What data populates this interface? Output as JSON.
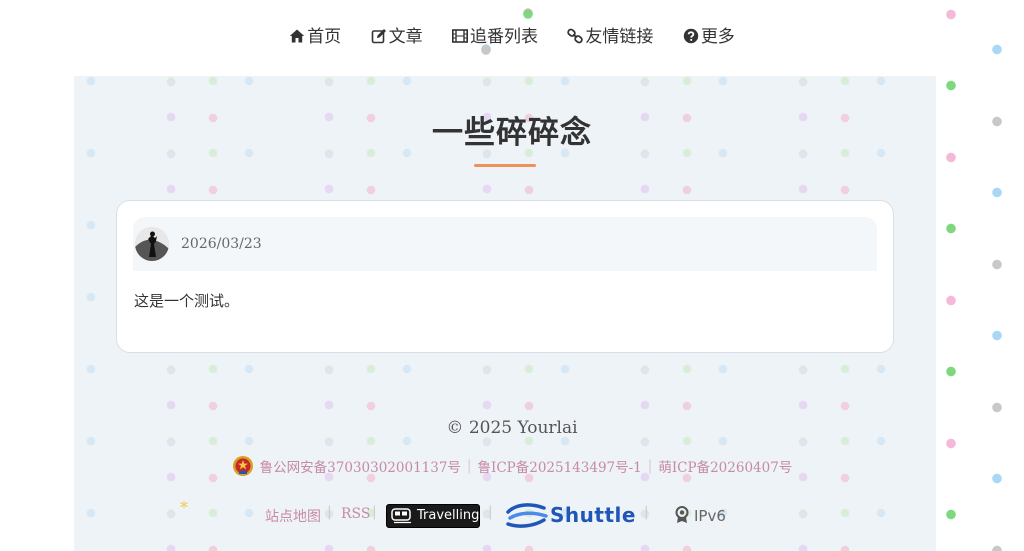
{
  "nav": {
    "items": [
      {
        "label": "首页",
        "icon": "home-icon"
      },
      {
        "label": "文章",
        "icon": "edit-icon"
      },
      {
        "label": "追番列表",
        "icon": "film-icon"
      },
      {
        "label": "友情链接",
        "icon": "link-icon"
      },
      {
        "label": "更多",
        "icon": "question-circle-icon"
      }
    ]
  },
  "page": {
    "title": "一些碎碎念",
    "accent": "#f0905a"
  },
  "post": {
    "date": "2026/03/23",
    "text": "这是一个测试。"
  },
  "footer": {
    "copyright": "© 2025 Yourlai",
    "beian": {
      "police": "鲁公网安备37030302001137号",
      "icp": "鲁ICP备2025143497号-1",
      "moe": "萌ICP备20260407号"
    },
    "links": {
      "sitemap": "站点地图",
      "rss": "RSS",
      "travelling": "Travelling",
      "shuttle": "Shuttle",
      "ipv6": "IPv6"
    }
  }
}
